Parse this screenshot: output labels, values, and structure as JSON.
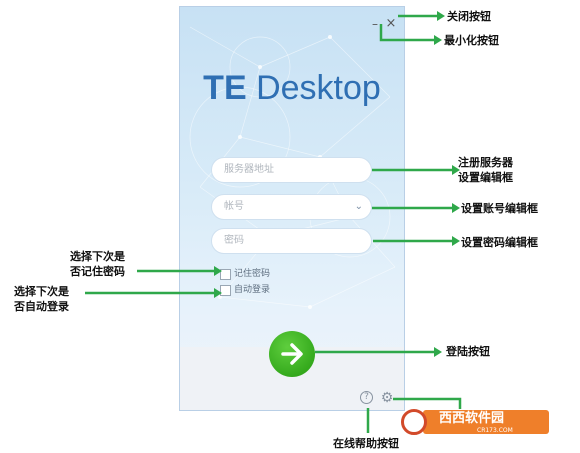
{
  "window": {
    "minimize_glyph": "–",
    "close_glyph": "×",
    "logo_bold": "TE",
    "logo_rest": "Desktop",
    "server_placeholder": "服务器地址",
    "account_placeholder": "帐号",
    "password_placeholder": "密码",
    "remember_password": "记住密码",
    "auto_login": "自动登录",
    "help_glyph": "?",
    "settings_glyph": "⚙"
  },
  "annotations": {
    "close": "关闭按钮",
    "minimize": "最小化按钮",
    "server_line1": "注册服务器",
    "server_line2": "设置编辑框",
    "account": "设置账号编辑框",
    "password": "设置密码编辑框",
    "remember_line1": "选择下次是",
    "remember_line2": "否记住密码",
    "auto_line1": "选择下次是",
    "auto_line2": "否自动登录",
    "login": "登陆按钮",
    "help": "在线帮助按钮"
  },
  "watermark": {
    "brand": "西西软件园",
    "url": "CR173.COM"
  },
  "colors": {
    "accent_green": "#35aa1d",
    "annotation_line": "#2fa84a",
    "logo_blue": "#2f6fb3"
  }
}
